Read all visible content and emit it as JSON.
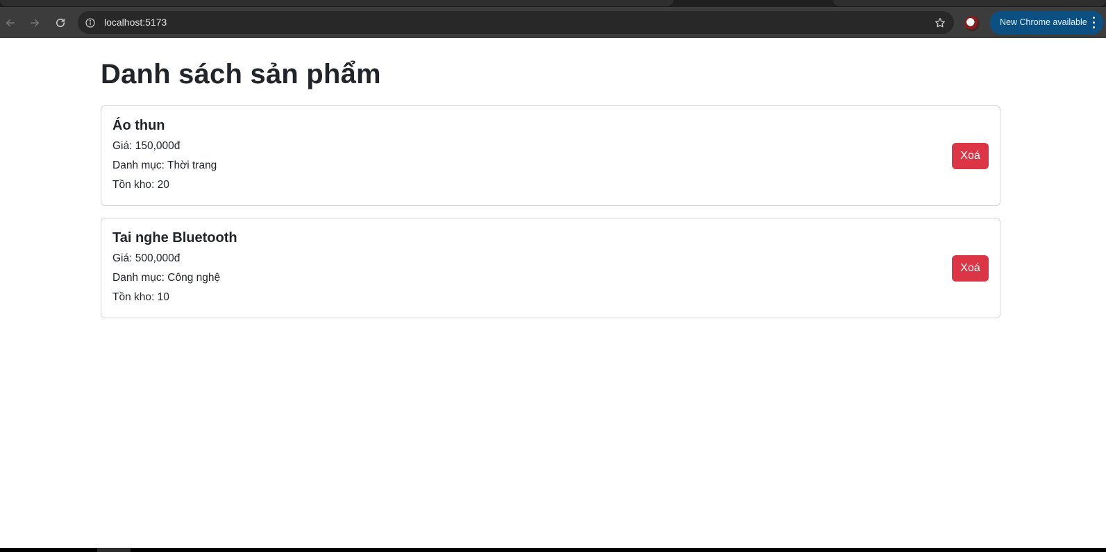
{
  "browser": {
    "url": "localhost:5173",
    "update_label": "New Chrome available",
    "icons": {
      "back": "arrow-left-icon",
      "forward": "arrow-right-icon",
      "reload": "reload-icon",
      "site_info": "info-icon",
      "bookmark": "star-icon",
      "menu": "kebab-menu-icon"
    },
    "colors": {
      "toolbar": "#3c3c3c",
      "omnibox": "#282828",
      "update_pill": "#0b5081"
    }
  },
  "page": {
    "title": "Danh sách sản phẩm",
    "products": [
      {
        "name": "Áo thun",
        "price": "Giá: 150,000đ",
        "category": "Danh mục: Thời trang",
        "stock": "Tồn kho: 20",
        "delete_label": "Xoá"
      },
      {
        "name": "Tai nghe Bluetooth",
        "price": "Giá: 500,000đ",
        "category": "Danh mục: Công nghệ",
        "stock": "Tồn kho: 10",
        "delete_label": "Xoá"
      }
    ],
    "colors": {
      "text": "#212529",
      "delete_button": "#dc3545",
      "card_border": "#d3d6d9"
    }
  }
}
